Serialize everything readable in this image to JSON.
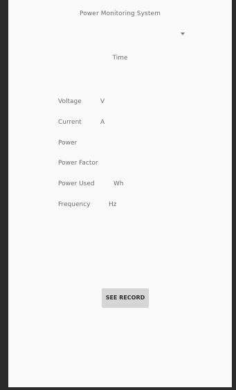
{
  "app": {
    "title": "Power Monitoring System"
  },
  "time_label": "Time",
  "spinner": {
    "icon": "dropdown-arrow-icon"
  },
  "readings": [
    {
      "label": "Voltage",
      "unit": "V"
    },
    {
      "label": "Current",
      "unit": "A"
    },
    {
      "label": "Power",
      "unit": ""
    },
    {
      "label": "Power Factor",
      "unit": ""
    },
    {
      "label": "Power Used",
      "unit": "Wh"
    },
    {
      "label": "Frequency",
      "unit": "Hz"
    }
  ],
  "buttons": {
    "see_record": "SEE RECORD"
  }
}
